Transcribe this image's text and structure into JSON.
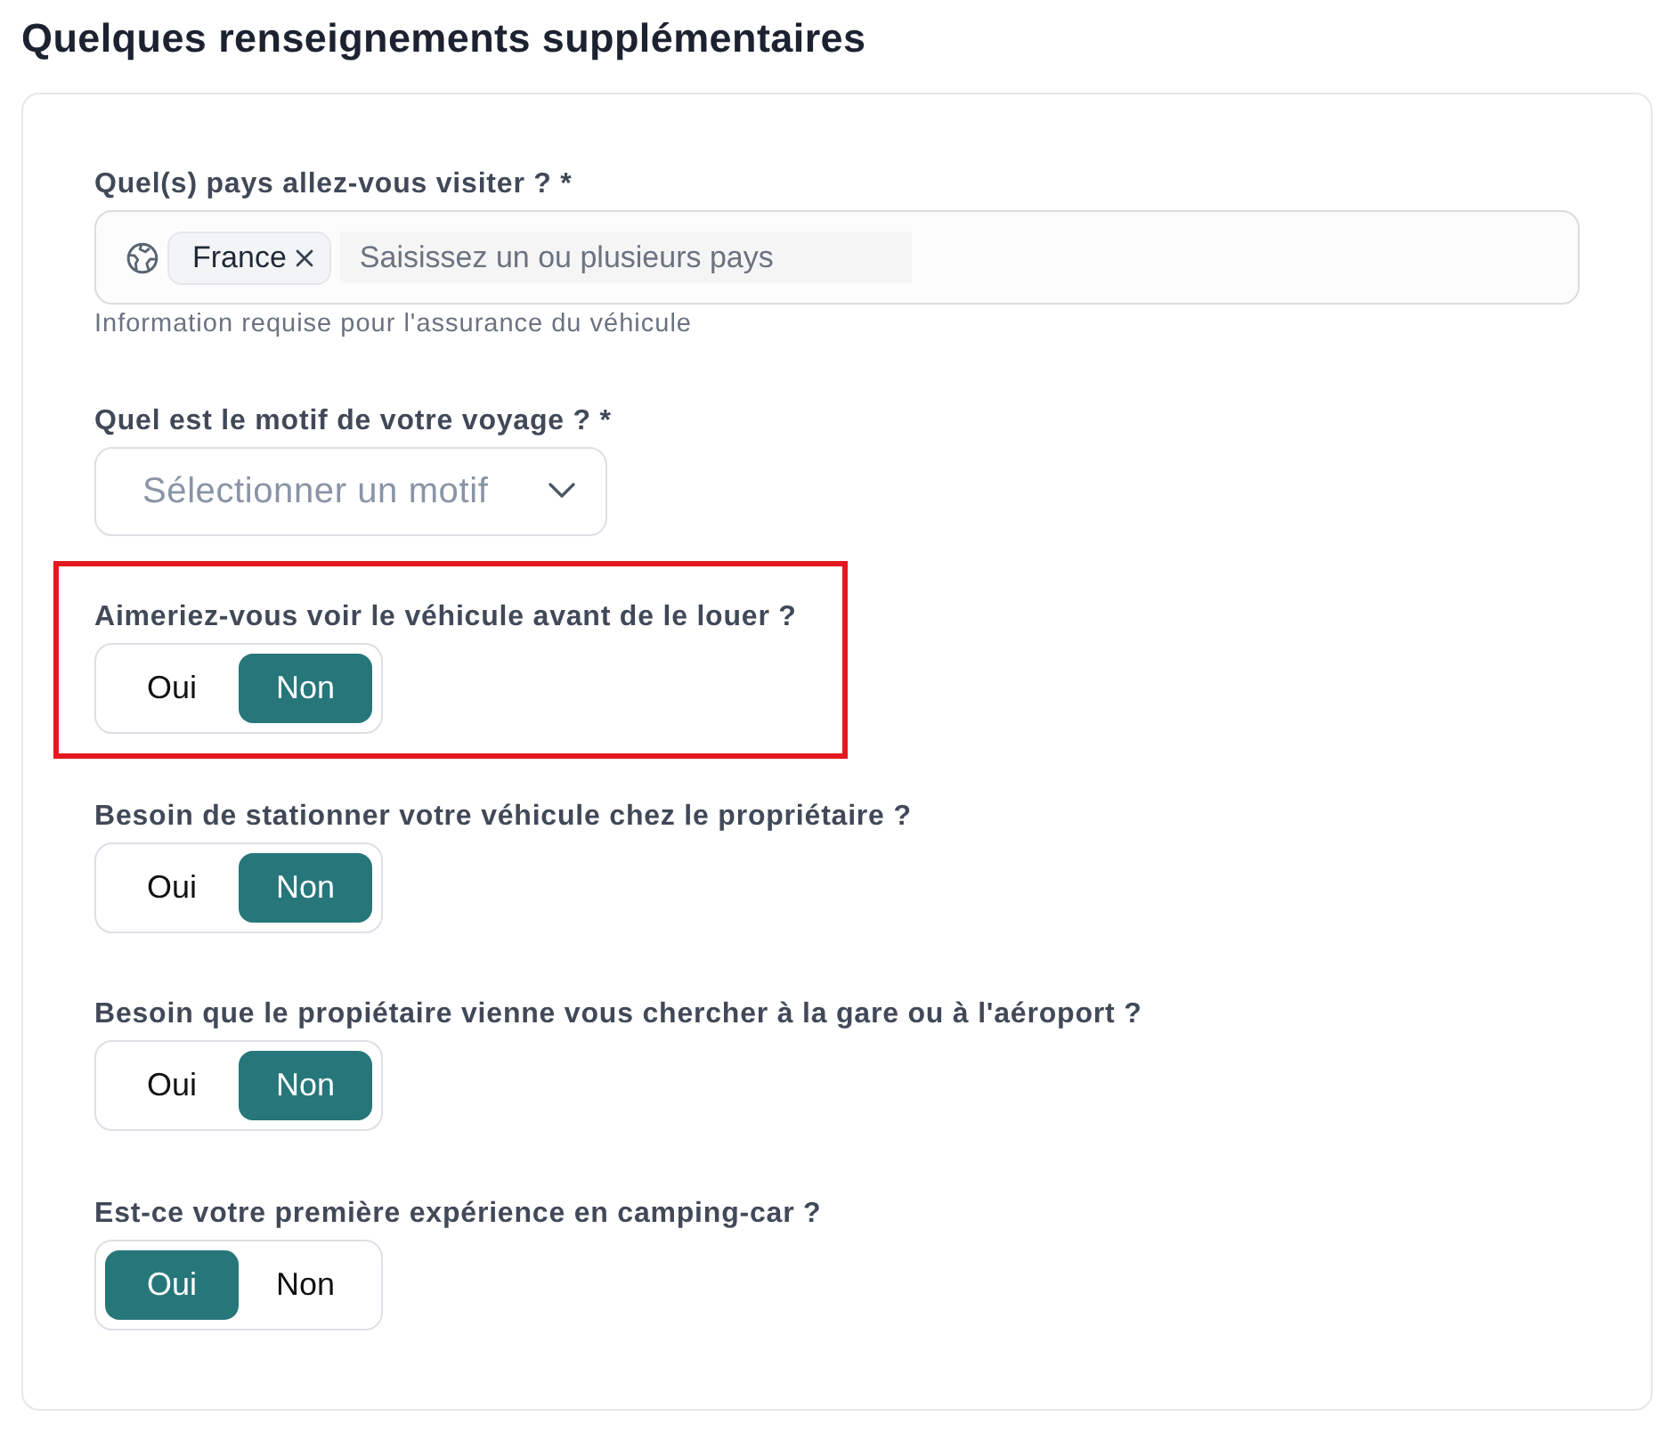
{
  "heading": "Quelques renseignements supplémentaires",
  "fields": [
    {
      "kind": "multiselect",
      "label": "Quel(s) pays allez-vous visiter ? *",
      "chips": [
        {
          "label": "France"
        }
      ],
      "placeholder": "Saisissez un ou plusieurs pays",
      "hint": "Information requise pour l'assurance du véhicule"
    },
    {
      "kind": "select",
      "label": "Quel est le motif de votre voyage ? *",
      "placeholder": "Sélectionner un motif"
    },
    {
      "kind": "toggle",
      "label": "Aimeriez-vous voir le véhicule avant de le louer ?",
      "highlighted": true,
      "options": [
        {
          "label": "Oui",
          "selected": false
        },
        {
          "label": "Non",
          "selected": true
        }
      ]
    },
    {
      "kind": "toggle",
      "label": "Besoin de stationner votre véhicule chez le propriétaire ?",
      "highlighted": false,
      "options": [
        {
          "label": "Oui",
          "selected": false
        },
        {
          "label": "Non",
          "selected": true
        }
      ]
    },
    {
      "kind": "toggle",
      "label": "Besoin que le propiétaire vienne vous chercher à la gare ou à l'aéroport ?",
      "highlighted": false,
      "options": [
        {
          "label": "Oui",
          "selected": false
        },
        {
          "label": "Non",
          "selected": true
        }
      ]
    },
    {
      "kind": "toggle",
      "label": "Est-ce votre première expérience en camping-car ?",
      "highlighted": false,
      "options": [
        {
          "label": "Oui",
          "selected": true
        },
        {
          "label": "Non",
          "selected": false
        }
      ]
    }
  ]
}
